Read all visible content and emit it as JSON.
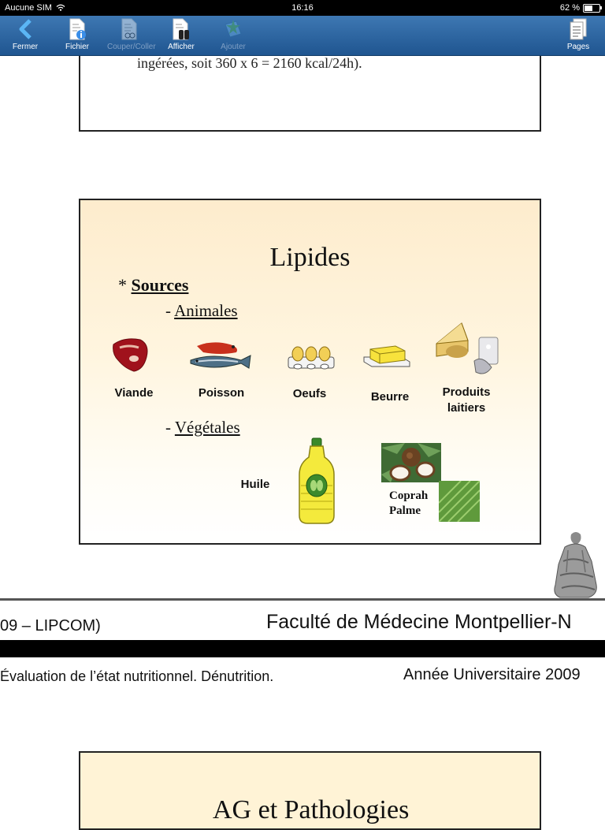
{
  "status_bar": {
    "carrier": "Aucune SIM",
    "time": "16:16",
    "battery": "62 %",
    "battery_level": 0.62
  },
  "toolbar": {
    "close": "Fermer",
    "file": "Fichier",
    "cut_paste": "Couper/Coller",
    "show": "Afficher",
    "add": "Ajouter",
    "pages": "Pages"
  },
  "slide_prev": {
    "snippet": "ingérées, soit 360 x 6 = 2160 kcal/24h)."
  },
  "slide": {
    "title": "Lipides",
    "bullet": "*",
    "sources": "Sources",
    "dash": "-",
    "animal_heading": "Animales",
    "vegetal_heading": "Végétales",
    "animal_items": [
      "Viande",
      "Poisson",
      "Oeufs",
      "Beurre",
      "Produits laitiers"
    ],
    "oil_label": "Huile",
    "coprah_label": "Coprah",
    "palme_label": "Palme"
  },
  "footer": {
    "left_text": "09 – LIPCOM)",
    "faculty": "Faculté de Médecine Montpellier-N",
    "eval_text": "Évaluation de l’état nutritionnel. Dénutrition.",
    "year_text": "Année Universitaire 2009"
  },
  "slide_next": {
    "title_partial": "AG et Pathologies"
  }
}
